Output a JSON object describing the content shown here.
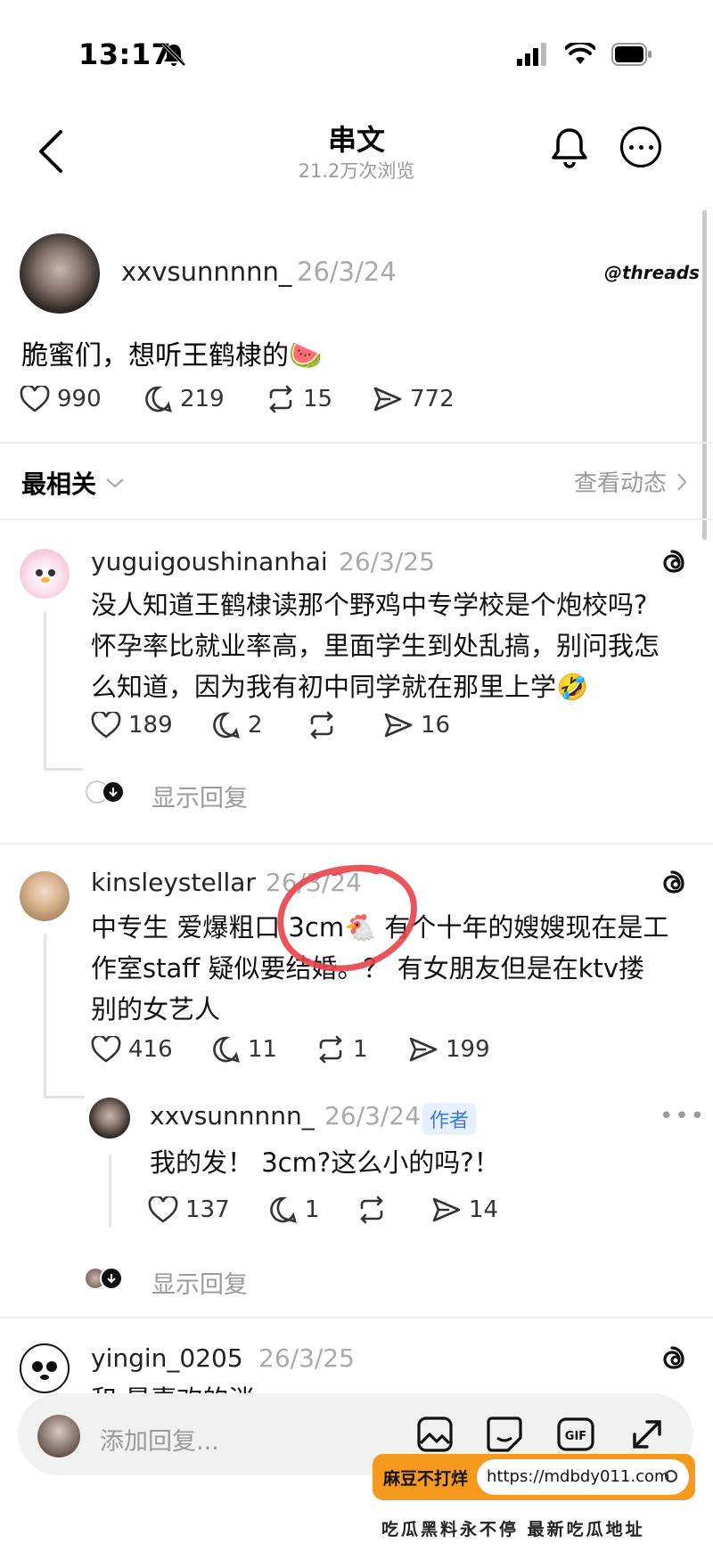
{
  "status": {
    "time": "13:17"
  },
  "header": {
    "title": "串文",
    "subtitle": "21.2万次浏览"
  },
  "post": {
    "username": "xxvsunnnnn_",
    "date": "26/3/24",
    "brand": "threads",
    "text": "脆蜜们，想听王鹤棣的🍉",
    "likes": "990",
    "comments": "219",
    "reposts": "15",
    "shares": "772"
  },
  "filter": {
    "sort_label": "最相关",
    "activity_label": "查看动态"
  },
  "comments": [
    {
      "username": "yuguigoushinanhai",
      "date": "26/3/25",
      "lines": [
        "没人知道王鹤棣读那个野鸡中专学校是个炮校吗?",
        "怀孕率比就业率高，里面学生到处乱搞，别问我怎",
        "么知道，因为我有初中同学就在那里上学🤣"
      ],
      "likes": "189",
      "comments": "2",
      "shares": "16",
      "show_replies": "显示回复"
    },
    {
      "username": "kinsleystellar",
      "date": "26/3/24",
      "lines": [
        "中专生 爱爆粗口 3cm🐔 有个十年的嫂嫂现在是工",
        "作室staff 疑似要结婚。？ 有女朋友但是在ktv搂",
        "别的女艺人"
      ],
      "likes": "416",
      "comments": "11",
      "reposts": "1",
      "shares": "199",
      "reply": {
        "username": "xxvsunnnnn_",
        "date": "26/3/24",
        "badge": "作者",
        "text": "我的发！ 3cm?这么小的吗?！",
        "likes": "137",
        "comments": "1",
        "shares": "14"
      },
      "show_replies": "显示回复"
    },
    {
      "username": "yingin_0205",
      "date": "26/3/25",
      "partial": "和 最喜欢的消"
    }
  ],
  "composer": {
    "placeholder": "添加回复..."
  },
  "ad": {
    "label": "麻豆不打烊",
    "url": "https://mdbdy011.com",
    "tagline": "吃瓜黑料永不停 最新吃瓜地址"
  },
  "colors": {
    "accent_badge": "#3b7be0",
    "ad_orange": "#f59a1e",
    "annotation_red": "#e8434a"
  }
}
